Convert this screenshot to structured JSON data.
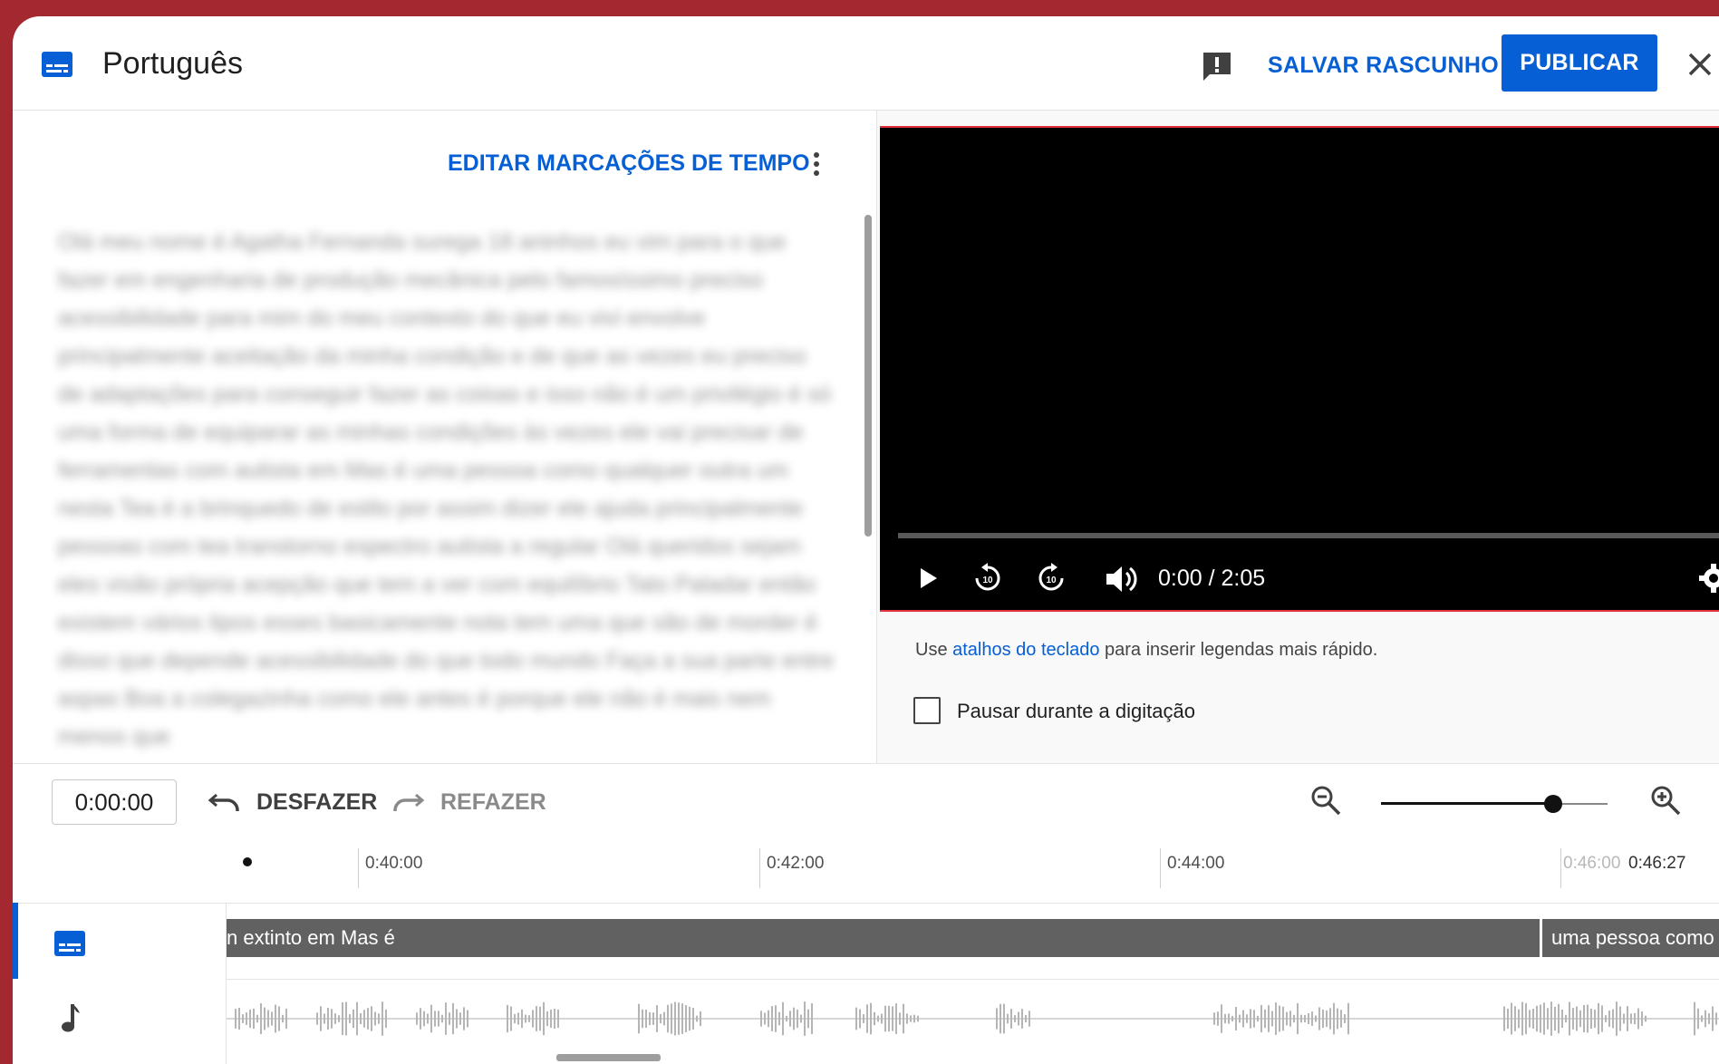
{
  "header": {
    "title": "Português",
    "save_draft": "SALVAR RASCUNHO",
    "publish": "PUBLICAR",
    "icons": [
      "subtitles-icon",
      "feedback-icon",
      "close-icon"
    ]
  },
  "editor": {
    "edit_timings": "EDITAR MARCAÇÕES DE TEMPO",
    "transcript": "Olá meu nome é Agatha Fernanda surega 18 aninhos eu vim para o que fazer em engenharia de produção mecânica pelo famosíssimo preciso acessibilidade para mim do meu contexto do que eu vivi envolve principalmente aceitação da minha condição e de que as vezes eu preciso de adaptações para conseguir fazer as coisas e isso não é um privilégio é só uma forma de equiparar as minhas condições às vezes ele vai precisar de ferramentas com autista em Mas é uma pessoa como qualquer outra um nesta Tea é a brinquedo de estilo por assim dizer ele ajuda principalmente pessoas com tea transtorno espectro autista a regular Olá queridos sejam eles visão própria acepção que tem a ver com equilíbrio Tato Paladar então existem vários tipos esses basicamente nota tem uma que são de morder é disso que depende acessibilidade do que todo mundo Faça a sua parte entre aspas Boa a colegazinha como ele antes é porque ele não é mais nem menos que"
  },
  "player": {
    "time": "0:00 / 2:05",
    "progress_fraction": 0.0,
    "hint_prefix": "Use ",
    "hint_link": "atalhos do teclado",
    "hint_suffix": " para inserir legendas mais rápido.",
    "pause_label": "Pausar durante a digitação",
    "pause_checked": false
  },
  "toolbar": {
    "time_value": "0:00:00",
    "undo": "DESFAZER",
    "redo": "REFAZER",
    "zoom_level_fraction": 0.76
  },
  "timeline": {
    "ticks": [
      "0:40:00",
      "0:42:00",
      "0:44:00",
      "0:46:00"
    ],
    "end_time": "0:46:27",
    "caption_segments": [
      "n extinto em Mas é",
      "uma pessoa como"
    ]
  },
  "colors": {
    "accent": "#065fd4",
    "background": "#a4282f",
    "caption_segment": "#616161"
  }
}
